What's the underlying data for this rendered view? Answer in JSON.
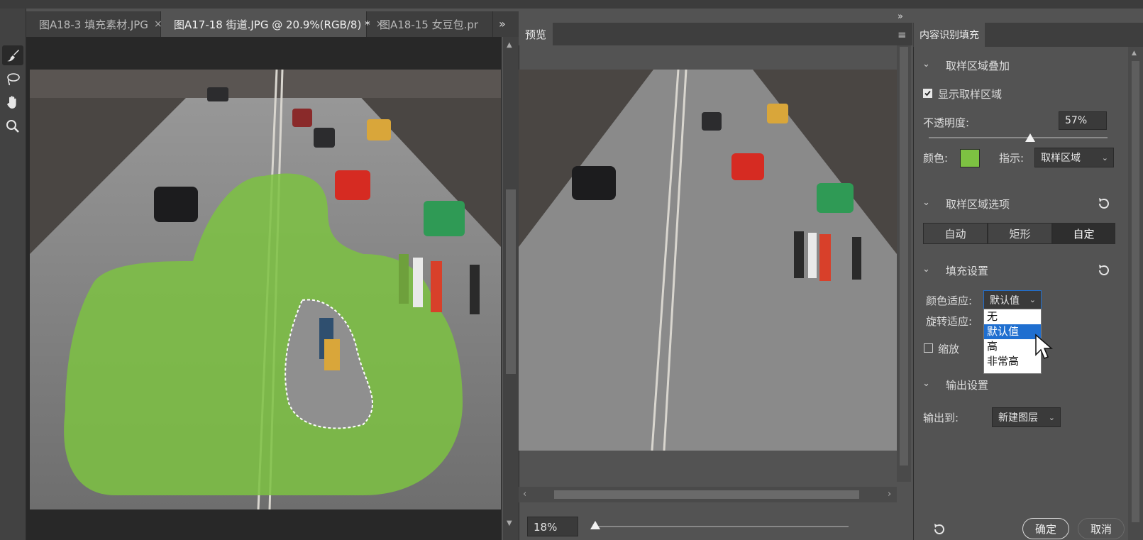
{
  "tabs": [
    {
      "label": "图A18-3 填充素材.JPG",
      "close": "×",
      "active": false
    },
    {
      "label": "图A17-18 街道.JPG @ 20.9%(RGB/8) *",
      "close": "×",
      "active": true
    },
    {
      "label": "图A18-15 女豆包.pr",
      "close": "",
      "active": false
    }
  ],
  "tab_overflow": "»",
  "tools": [
    "brush-tool",
    "lasso-tool",
    "hand-tool",
    "zoom-tool"
  ],
  "preview": {
    "tab_label": "预览",
    "zoom": "18%",
    "zoom_fraction": 0.0
  },
  "panel": {
    "title": "内容识别填充",
    "sampling_overlay": {
      "heading": "取样区域叠加",
      "show_label": "显示取样区域",
      "show_checked": true,
      "opacity_label": "不透明度:",
      "opacity_value": "57%",
      "opacity_fraction": 0.57,
      "color_label": "颜色:",
      "color": "#7dc242",
      "indicate_label": "指示:",
      "indicate_value": "取样区域"
    },
    "sampling_options": {
      "heading": "取样区域选项",
      "buttons": [
        "自动",
        "矩形",
        "自定"
      ],
      "selected": "自定"
    },
    "fill_settings": {
      "heading": "填充设置",
      "color_adapt_label": "颜色适应:",
      "color_adapt_value": "默认值",
      "rotation_adapt_label": "旋转适应:",
      "scale_label": "缩放",
      "scale_checked": false,
      "dropdown_options": [
        "无",
        "默认值",
        "高",
        "非常高"
      ],
      "dropdown_selected": "默认值"
    },
    "output": {
      "heading": "输出设置",
      "output_label": "输出到:",
      "output_value": "新建图层"
    },
    "ok_label": "确定",
    "cancel_label": "取消"
  },
  "colors": {
    "accent_blue": "#1f6fd0",
    "sample_green": "#7dc242"
  }
}
